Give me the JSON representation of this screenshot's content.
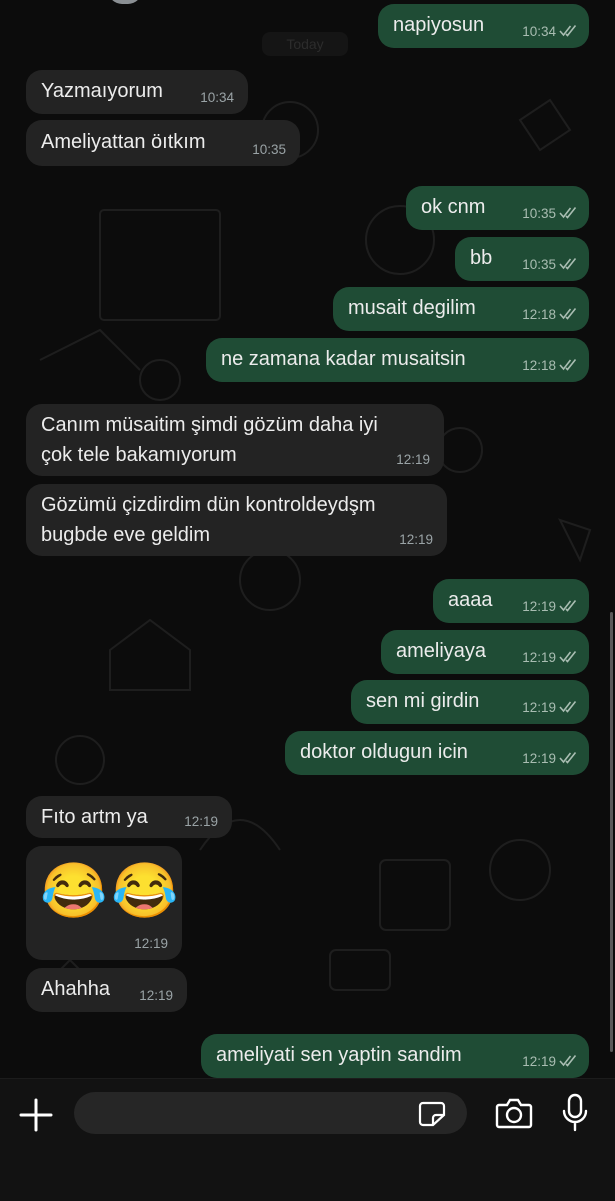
{
  "chat": {
    "date_separator": "Today",
    "messages": [
      {
        "dir": "out",
        "text": "napiyosun",
        "time": "10:34",
        "read": true
      },
      {
        "dir": "in",
        "text": "Yazmaıyorum",
        "time": "10:34"
      },
      {
        "dir": "in",
        "text": "Ameliyattan öıtkım",
        "time": "10:35"
      },
      {
        "dir": "out",
        "text": "ok cnm",
        "time": "10:35",
        "read": true
      },
      {
        "dir": "out",
        "text": "bb",
        "time": "10:35",
        "read": true
      },
      {
        "dir": "out",
        "text": "musait degilim",
        "time": "12:18",
        "read": true
      },
      {
        "dir": "out",
        "text": "ne zamana kadar musaitsin",
        "time": "12:18",
        "read": true
      },
      {
        "dir": "in",
        "line1": "Canım müsaitim şimdi gözüm daha iyi",
        "line2": "çok tele bakamıyorum",
        "time": "12:19"
      },
      {
        "dir": "in",
        "line1": "Gözümü çizdirdim dün kontroldeydşm",
        "line2": "bugbde eve geldim",
        "time": "12:19"
      },
      {
        "dir": "out",
        "text": "aaaa",
        "time": "12:19",
        "read": true
      },
      {
        "dir": "out",
        "text": "ameliyaya",
        "time": "12:19",
        "read": true
      },
      {
        "dir": "out",
        "text": "sen mi girdin",
        "time": "12:19",
        "read": true
      },
      {
        "dir": "out",
        "text": "doktor oldugun icin",
        "time": "12:19",
        "read": true
      },
      {
        "dir": "in",
        "text": "Fıto artm ya",
        "time": "12:19"
      },
      {
        "dir": "in",
        "emoji": "😂😂",
        "time": "12:19"
      },
      {
        "dir": "in",
        "text": "Ahahha",
        "time": "12:19"
      },
      {
        "dir": "out",
        "text": "ameliyati sen yaptin sandim",
        "time": "12:19",
        "read": true
      }
    ]
  },
  "composer": {
    "placeholder": "",
    "icons": [
      "plus-icon",
      "sticker-icon",
      "camera-icon",
      "microphone-icon"
    ]
  },
  "colors": {
    "incoming_bubble": "#232323",
    "outgoing_bubble": "#1f4c35",
    "background": "#0c0c0c",
    "read_tick": "#a9bdb2"
  }
}
